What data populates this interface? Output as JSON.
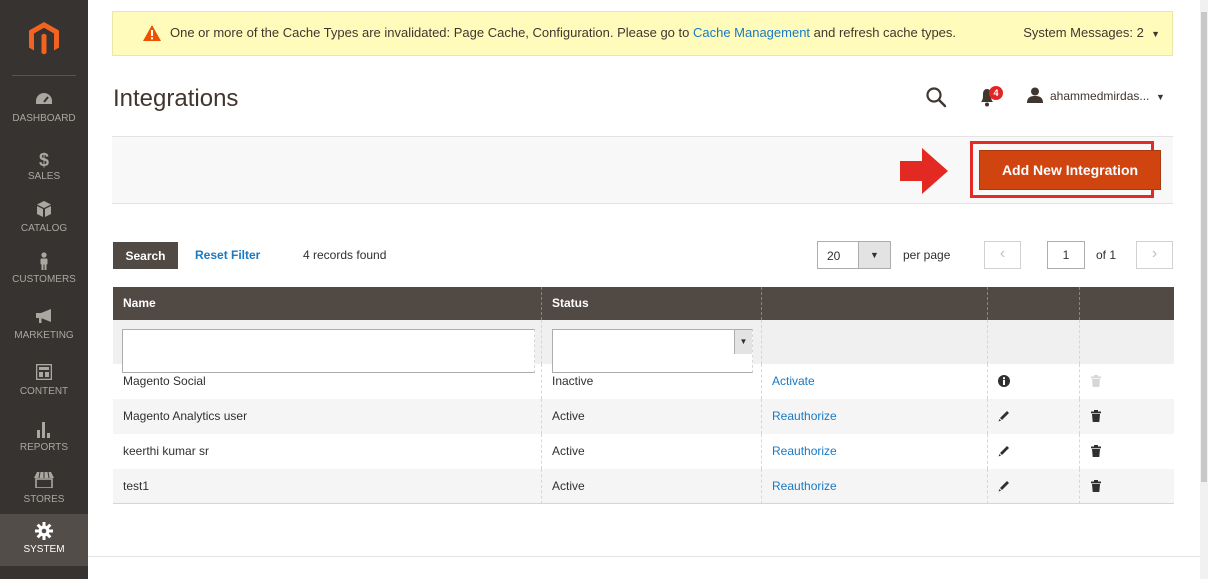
{
  "sidebar": {
    "items": [
      {
        "label": "DASHBOARD",
        "icon": "dashboard-icon"
      },
      {
        "label": "SALES",
        "icon": "dollar-icon"
      },
      {
        "label": "CATALOG",
        "icon": "box-icon"
      },
      {
        "label": "CUSTOMERS",
        "icon": "person-icon"
      },
      {
        "label": "MARKETING",
        "icon": "megaphone-icon"
      },
      {
        "label": "CONTENT",
        "icon": "layout-icon"
      },
      {
        "label": "REPORTS",
        "icon": "bar-chart-icon"
      },
      {
        "label": "STORES",
        "icon": "storefront-icon"
      },
      {
        "label": "SYSTEM",
        "icon": "gear-icon"
      }
    ]
  },
  "message": {
    "text_before": "One or more of the Cache Types are invalidated: Page Cache, Configuration. Please go to ",
    "link": "Cache Management",
    "text_after": " and refresh cache types.",
    "system_messages": "System Messages: 2",
    "warning_color": "#eb5202"
  },
  "header": {
    "title": "Integrations",
    "notification_count": "4",
    "user": "ahammedmirdas..."
  },
  "actions": {
    "add_label": "Add New Integration",
    "accent": "#d0440f",
    "highlight_color": "#e02b27"
  },
  "toolbar": {
    "search_label": "Search",
    "reset_label": "Reset Filter",
    "records": "4 records found",
    "per_page_value": "20",
    "per_page_label": "per page",
    "page": "1",
    "of_label": "of 1"
  },
  "grid": {
    "columns": [
      "Name",
      "Status",
      "",
      "",
      ""
    ],
    "rows": [
      {
        "name": "Magento Social",
        "status": "Inactive",
        "action": "Activate",
        "icon4": "info-icon",
        "icon5": "trash-icon-disabled"
      },
      {
        "name": "Magento Analytics user",
        "status": "Active",
        "action": "Reauthorize",
        "icon4": "pencil-icon",
        "icon5": "trash-icon"
      },
      {
        "name": "keerthi kumar sr",
        "status": "Active",
        "action": "Reauthorize",
        "icon4": "pencil-icon",
        "icon5": "trash-icon"
      },
      {
        "name": "test1",
        "status": "Active",
        "action": "Reauthorize",
        "icon4": "pencil-icon",
        "icon5": "trash-icon"
      }
    ]
  }
}
